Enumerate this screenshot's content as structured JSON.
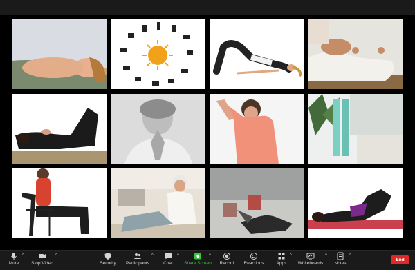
{
  "participants": [
    {
      "id": "p1",
      "scene": "woman lying back, head tilted, eyes closed"
    },
    {
      "id": "p2",
      "scene": "sun salutation sequence diagram"
    },
    {
      "id": "p3",
      "scene": "woman in bridge pose"
    },
    {
      "id": "p4",
      "scene": "meditating hands, seated"
    },
    {
      "id": "p5",
      "scene": "woman lying with knees bent"
    },
    {
      "id": "p6",
      "scene": "older woman, hands in prayer"
    },
    {
      "id": "p7",
      "scene": "woman stretching, coral top"
    },
    {
      "id": "p8",
      "scene": "legs up the wall"
    },
    {
      "id": "p9",
      "scene": "woman seated on chair"
    },
    {
      "id": "p10",
      "scene": "older woman seated on floor"
    },
    {
      "id": "p11",
      "scene": "lying with legs on wall, dim room"
    },
    {
      "id": "p12",
      "scene": "knees to chest on mat"
    }
  ],
  "toolbar": {
    "mute": "Mute",
    "stop_video": "Stop Video",
    "security": "Security",
    "participants": "Participants",
    "participants_count": "12",
    "chat": "Chat",
    "share_screen": "Share Screen",
    "record": "Record",
    "reactions": "Reactions",
    "apps": "Apps",
    "whiteboards": "Whiteboards",
    "notes": "Notes",
    "end": "End"
  },
  "icons": {
    "mute": "microphone-icon",
    "video": "video-camera-icon",
    "security": "shield-icon",
    "participants": "people-icon",
    "chat": "chat-bubble-icon",
    "share": "share-screen-icon",
    "record": "record-icon",
    "reactions": "smiley-icon",
    "apps": "apps-icon",
    "whiteboards": "whiteboard-icon",
    "notes": "notes-icon"
  },
  "colors": {
    "end": "#e02828",
    "share": "#3ec23e",
    "toolbar_bg": "#1a1a1a"
  }
}
